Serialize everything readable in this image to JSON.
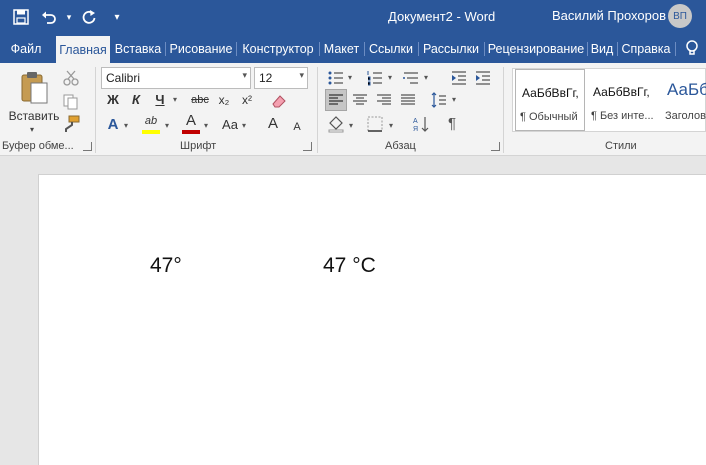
{
  "titlebar": {
    "document_title": "Документ2  -  Word",
    "user_name": "Василий Прохоров",
    "user_initials": "ВП",
    "qat_customize_label": "▾"
  },
  "tabs": [
    {
      "label": "Файл",
      "active": false
    },
    {
      "label": "Главная",
      "active": true
    },
    {
      "label": "Вставка",
      "active": false
    },
    {
      "label": "Рисование",
      "active": false
    },
    {
      "label": "Конструктор",
      "active": false
    },
    {
      "label": "Макет",
      "active": false
    },
    {
      "label": "Ссылки",
      "active": false
    },
    {
      "label": "Рассылки",
      "active": false
    },
    {
      "label": "Рецензирование",
      "active": false
    },
    {
      "label": "Вид",
      "active": false
    },
    {
      "label": "Справка",
      "active": false
    }
  ],
  "clipboard": {
    "paste_label": "Вставить",
    "group_label": "Буфер обме..."
  },
  "font": {
    "font_name": "Calibri",
    "font_size": "12",
    "bold_label": "Ж",
    "italic_label": "К",
    "underline_label": "Ч",
    "strikethrough_label": "abc",
    "subscript_label": "x₂",
    "superscript_label": "x²",
    "text_effects_label": "A",
    "highlight_label": "ab",
    "font_color_label": "A",
    "change_case_label": "Aa",
    "grow_font_label": "A",
    "shrink_font_label": "A",
    "group_label": "Шрифт"
  },
  "paragraph": {
    "group_label": "Абзац",
    "show_marks_label": "¶"
  },
  "styles": {
    "group_label": "Стили",
    "items": [
      {
        "sample": "АаБбВвГг,",
        "name": "¶ Обычный"
      },
      {
        "sample": "АаБбВвГг,",
        "name": "¶ Без инте..."
      },
      {
        "sample": "АаБб",
        "name": "Заголов"
      }
    ]
  },
  "document": {
    "text_1": "47°",
    "text_2": "47 °C"
  },
  "colors": {
    "brand": "#2b579a",
    "ribbon_bg": "#f3f3f3",
    "doc_bg": "#e6e6e6",
    "font_color_bar": "#c00000",
    "highlight_bar": "#ffff00"
  }
}
